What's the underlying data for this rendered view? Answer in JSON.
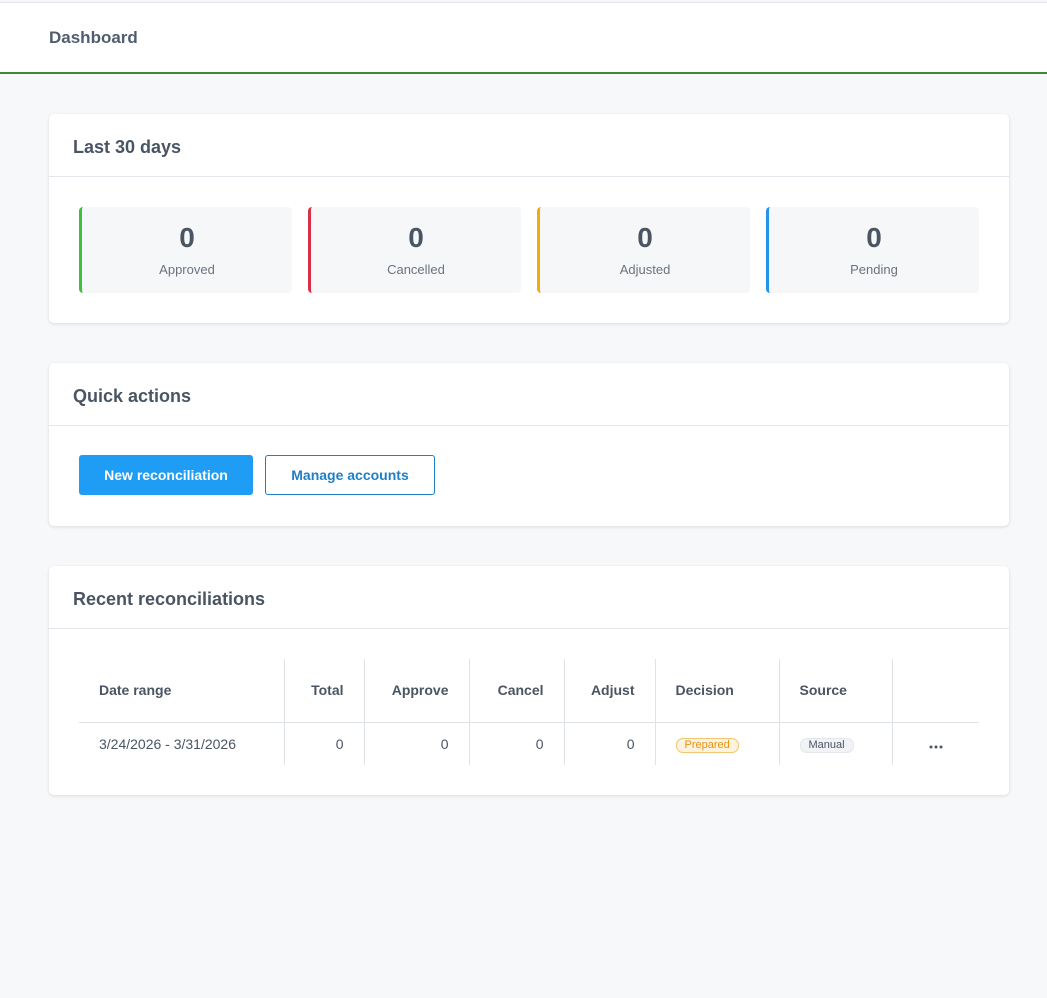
{
  "header": {
    "title": "Dashboard"
  },
  "stats_card": {
    "title": "Last 30 days",
    "stats": [
      {
        "value": "0",
        "label": "Approved",
        "color": "#3fbf3f"
      },
      {
        "value": "0",
        "label": "Cancelled",
        "color": "#d9304a"
      },
      {
        "value": "0",
        "label": "Adjusted",
        "color": "#f2ab0c"
      },
      {
        "value": "0",
        "label": "Pending",
        "color": "#2493ea"
      }
    ]
  },
  "actions_card": {
    "title": "Quick actions",
    "new_label": "New reconciliation",
    "manage_label": "Manage accounts"
  },
  "recent_card": {
    "title": "Recent reconciliations",
    "columns": [
      "Date range",
      "Total",
      "Approve",
      "Cancel",
      "Adjust",
      "Decision",
      "Source",
      ""
    ],
    "rows": [
      {
        "date_range": "3/24/2026 - 3/31/2026",
        "total": "0",
        "approve": "0",
        "cancel": "0",
        "adjust": "0",
        "decision": "Prepared",
        "source": "Manual",
        "menu_icon": "more-horizontal-icon"
      }
    ]
  }
}
